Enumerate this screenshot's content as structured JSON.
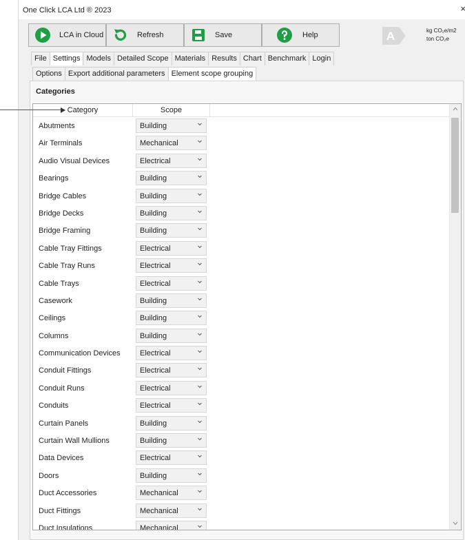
{
  "window": {
    "title": "One Click LCA Ltd ® 2023",
    "close_glyph": "×"
  },
  "toolbar": {
    "buttons": [
      {
        "label": "LCA in Cloud",
        "icon": "play-circle-icon"
      },
      {
        "label": "Refresh",
        "icon": "refresh-icon"
      },
      {
        "label": "Save",
        "icon": "floppy-disk-icon"
      },
      {
        "label": "Help",
        "icon": "question-circle-icon"
      }
    ],
    "grade": "A",
    "units_line1": "kg CO₂e/m2",
    "units_line2": "ton CO₂e"
  },
  "tabs": [
    "File",
    "Settings",
    "Models",
    "Detailed Scope",
    "Materials",
    "Results",
    "Chart",
    "Benchmark",
    "Login"
  ],
  "active_tab": "Settings",
  "subtabs": [
    "Options",
    "Export additional parameters",
    "Element scope grouping"
  ],
  "active_subtab": "Element scope grouping",
  "section_title": "Categories",
  "grid": {
    "columns": [
      "Category",
      "Scope"
    ],
    "rows": [
      {
        "category": "Abutments",
        "scope": "Building"
      },
      {
        "category": "Air Terminals",
        "scope": "Mechanical"
      },
      {
        "category": "Audio Visual Devices",
        "scope": "Electrical"
      },
      {
        "category": "Bearings",
        "scope": "Building"
      },
      {
        "category": "Bridge Cables",
        "scope": "Building"
      },
      {
        "category": "Bridge Decks",
        "scope": "Building"
      },
      {
        "category": "Bridge Framing",
        "scope": "Building"
      },
      {
        "category": "Cable Tray Fittings",
        "scope": "Electrical"
      },
      {
        "category": "Cable Tray Runs",
        "scope": "Electrical"
      },
      {
        "category": "Cable Trays",
        "scope": "Electrical"
      },
      {
        "category": "Casework",
        "scope": "Building"
      },
      {
        "category": "Ceilings",
        "scope": "Building"
      },
      {
        "category": "Columns",
        "scope": "Building"
      },
      {
        "category": "Communication Devices",
        "scope": "Electrical"
      },
      {
        "category": "Conduit Fittings",
        "scope": "Electrical"
      },
      {
        "category": "Conduit Runs",
        "scope": "Electrical"
      },
      {
        "category": "Conduits",
        "scope": "Electrical"
      },
      {
        "category": "Curtain Panels",
        "scope": "Building"
      },
      {
        "category": "Curtain Wall Mullions",
        "scope": "Building"
      },
      {
        "category": "Data Devices",
        "scope": "Electrical"
      },
      {
        "category": "Doors",
        "scope": "Building"
      },
      {
        "category": "Duct Accessories",
        "scope": "Mechanical"
      },
      {
        "category": "Duct Fittings",
        "scope": "Mechanical"
      },
      {
        "category": "Duct Insulations",
        "scope": "Mechanical"
      }
    ]
  },
  "colors": {
    "toolbar_icon_green": "#1f9e45",
    "window_bg": "#f0f0f0",
    "grade_badge": "#d9d9d9"
  }
}
